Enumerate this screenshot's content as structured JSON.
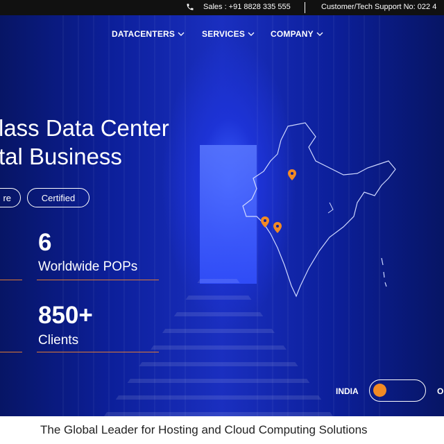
{
  "topbar": {
    "sales": "Sales : +91 8828 335 555",
    "support": "Customer/Tech Support No: 022 4"
  },
  "nav": {
    "datacenters": "DATACENTERS",
    "services": "SERVICES",
    "company": "COMPANY"
  },
  "hero": {
    "headline_line1": "lass Data Center",
    "headline_line2": "tal Business",
    "pill1": "re",
    "pill2": "Certified"
  },
  "stats": [
    {
      "value": "6",
      "label": "Worldwide POPs"
    },
    {
      "value": "850+",
      "label": "Clients"
    }
  ],
  "toggle": {
    "left_label": "INDIA",
    "right_label": "O"
  },
  "footer": {
    "tagline": "The Global Leader for Hosting and Cloud Computing Solutions"
  },
  "colors": {
    "accent": "#f28a24",
    "hero_blue": "#1a2fc0",
    "topbar": "#111111"
  },
  "icons": [
    "phone-icon",
    "chevron-down-icon",
    "map-pin-icon",
    "india-map"
  ]
}
